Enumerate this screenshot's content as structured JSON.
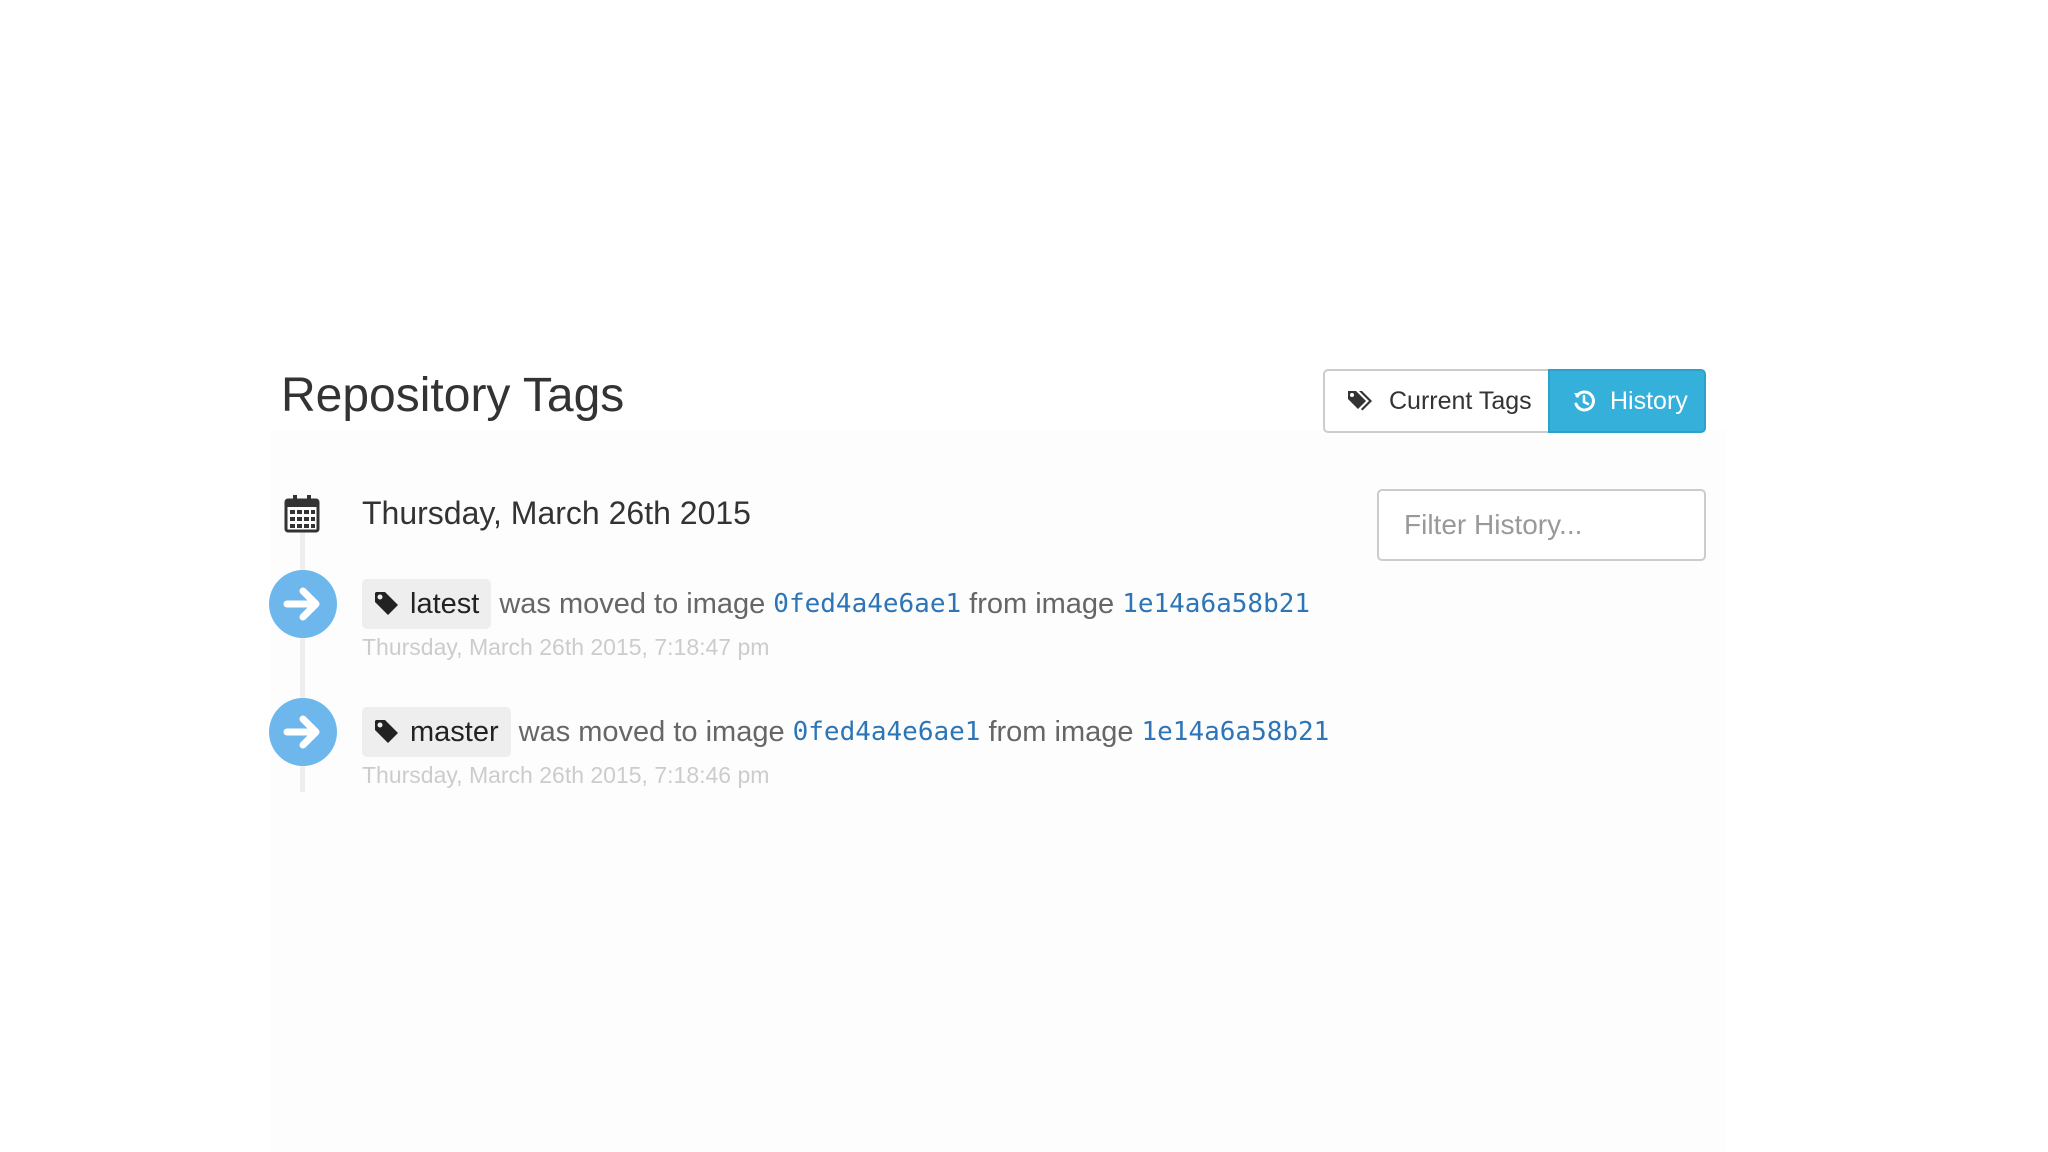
{
  "page": {
    "title": "Repository Tags"
  },
  "view_toggle": {
    "current_tags_label": "Current Tags",
    "history_label": "History",
    "active": "History",
    "accent_color": "#35b0db"
  },
  "filter": {
    "placeholder": "Filter History...",
    "value": ""
  },
  "history": {
    "date_heading": "Thursday, March 26th 2015",
    "date_icon": "calendar-icon",
    "entries": [
      {
        "icon": "arrow-right-icon",
        "tag": "latest",
        "action_text": "was moved to image",
        "to_image": "0fed4a4e6ae1",
        "from_text": "from image",
        "from_image": "1e14a6a58b21",
        "timestamp": "Thursday, March 26th 2015, 7:18:47 pm"
      },
      {
        "icon": "arrow-right-icon",
        "tag": "master",
        "action_text": "was moved to image",
        "to_image": "0fed4a4e6ae1",
        "from_text": "from image",
        "from_image": "1e14a6a58b21",
        "timestamp": "Thursday, March 26th 2015, 7:18:46 pm"
      }
    ]
  },
  "colors": {
    "link": "#2c75b8",
    "timeline_icon": "#6db7ec",
    "timestamp": "#cccccc"
  }
}
